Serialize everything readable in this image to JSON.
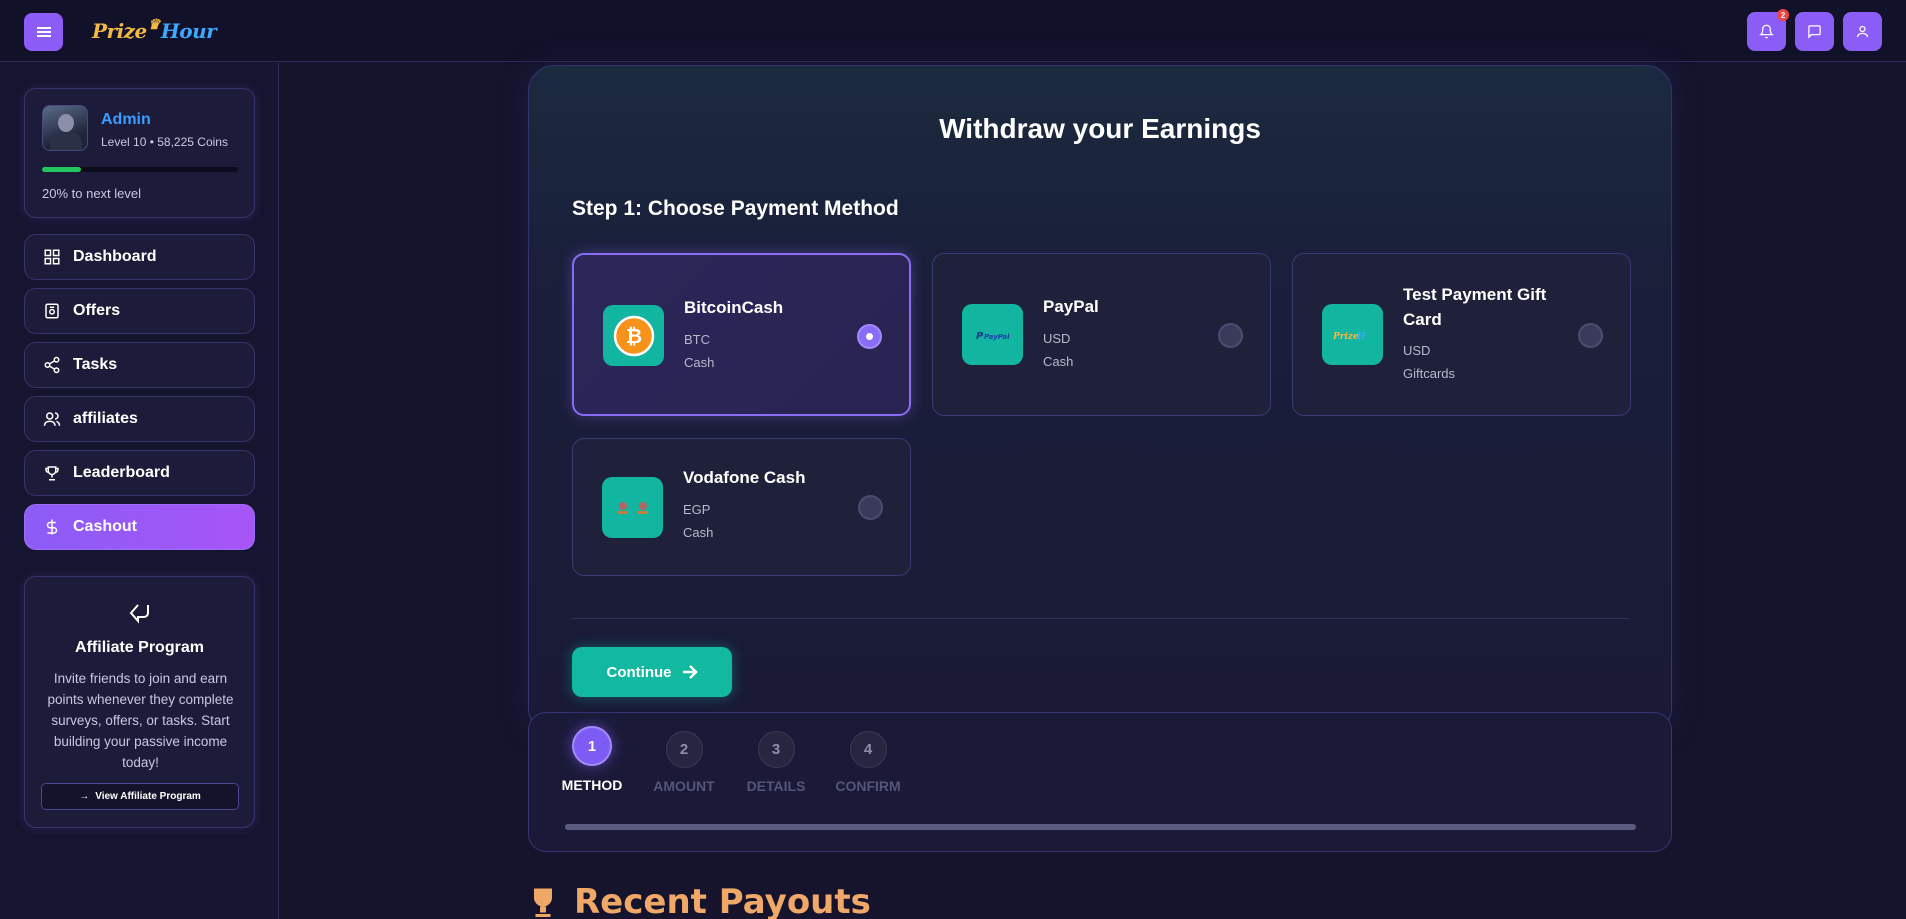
{
  "app": {
    "logo_part1": "Prize",
    "logo_part2": "Hour"
  },
  "header": {
    "notification_count": "2"
  },
  "profile": {
    "name": "Admin",
    "stats": "Level 10 • 58,225 Coins",
    "progress_percent": 20,
    "next_level_text": "20% to next level"
  },
  "nav": [
    {
      "label": "Dashboard",
      "icon": "grid-icon"
    },
    {
      "label": "Offers",
      "icon": "offers-icon"
    },
    {
      "label": "Tasks",
      "icon": "share-icon"
    },
    {
      "label": "affiliates",
      "icon": "users-icon"
    },
    {
      "label": "Leaderboard",
      "icon": "trophy-icon"
    },
    {
      "label": "Cashout",
      "icon": "dollar-icon",
      "active": true
    }
  ],
  "affiliate": {
    "title": "Affiliate Program",
    "text": "Invite friends to join and earn points whenever they complete surveys, offers, or tasks. Start building your passive income today!",
    "button": "View Affiliate Program"
  },
  "withdraw": {
    "title": "Withdraw your Earnings",
    "step_title": "Step 1: Choose Payment Method",
    "methods": [
      {
        "name": "BitcoinCash",
        "currency": "BTC",
        "type": "Cash",
        "selected": true
      },
      {
        "name": "PayPal",
        "currency": "USD",
        "type": "Cash",
        "selected": false
      },
      {
        "name": "Test Payment Gift Card",
        "currency": "USD",
        "type": "Giftcards",
        "selected": false
      },
      {
        "name": "Vodafone Cash",
        "currency": "EGP",
        "type": "Cash",
        "selected": false
      }
    ],
    "continue_label": "Continue"
  },
  "stepper": {
    "steps": [
      {
        "num": "1",
        "label": "METHOD",
        "active": true
      },
      {
        "num": "2",
        "label": "AMOUNT"
      },
      {
        "num": "3",
        "label": "DETAILS"
      },
      {
        "num": "4",
        "label": "CONFIRM"
      }
    ]
  },
  "recent": {
    "title": "Recent Payouts"
  },
  "colors": {
    "accent": "#8b5cf6",
    "teal": "#12b8a0",
    "link": "#3b9cff",
    "progress": "#22c55e"
  }
}
